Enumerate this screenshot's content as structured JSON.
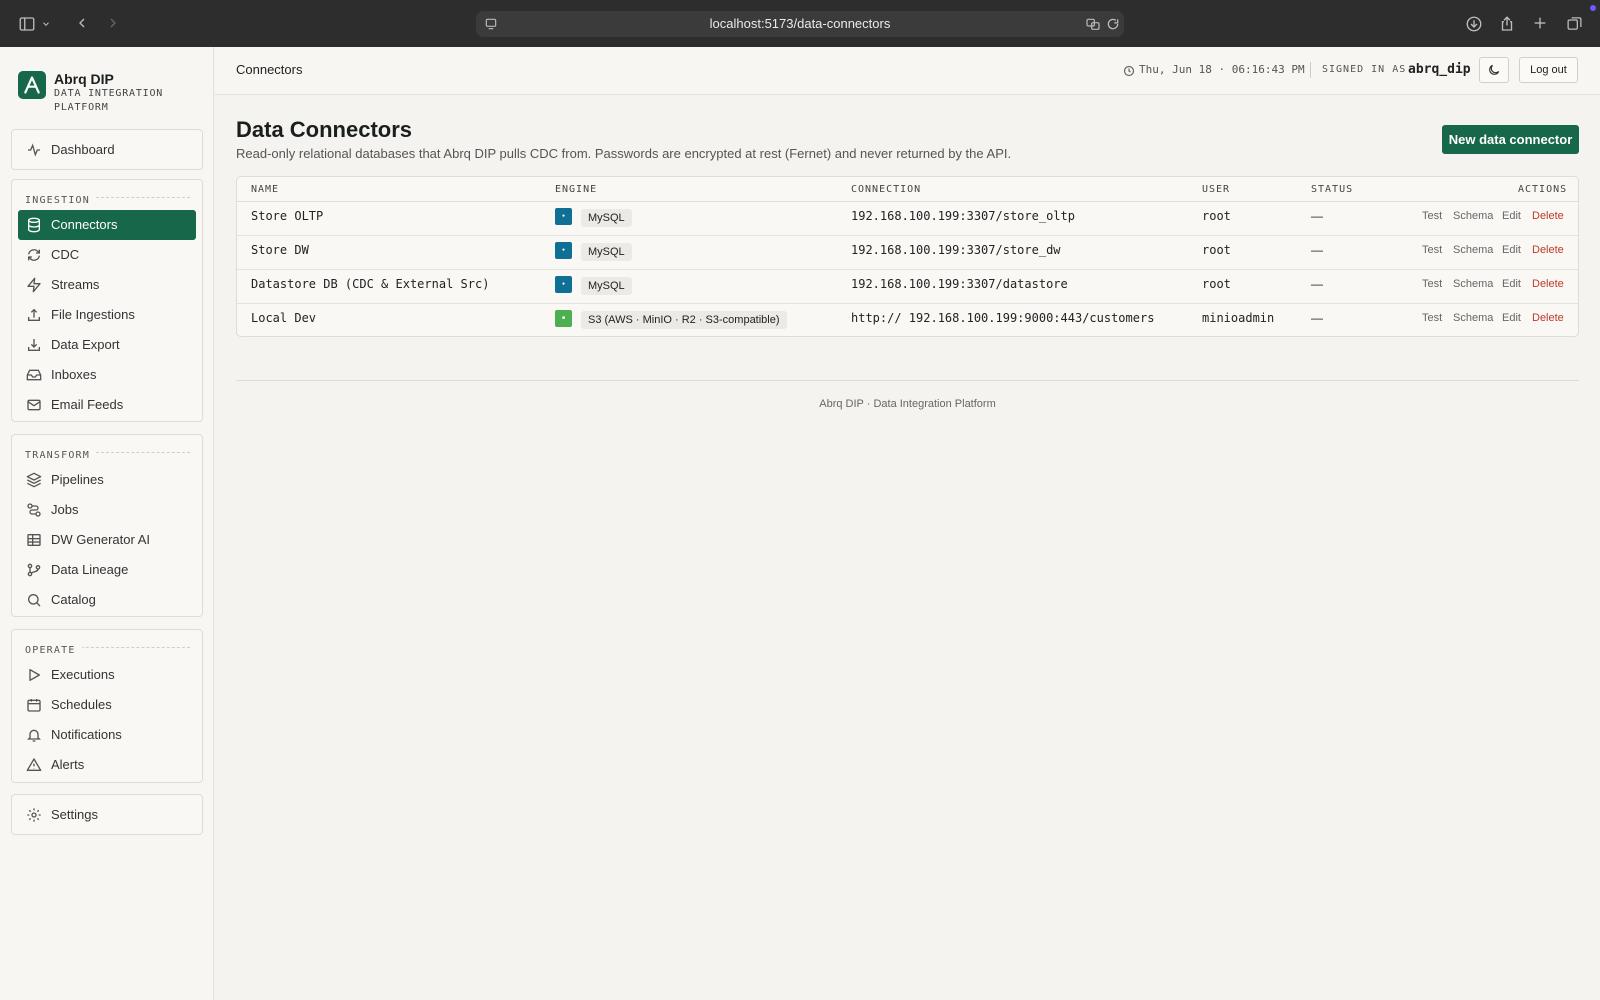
{
  "browser": {
    "url": "localhost:5173/data-connectors"
  },
  "brand": {
    "name": "Abrq DIP",
    "subtitle": "DATA INTEGRATION PLATFORM"
  },
  "sidebar": {
    "top_item": {
      "label": "Dashboard",
      "icon": "activity-icon"
    },
    "sections": [
      {
        "title": "INGESTION",
        "items": [
          {
            "label": "Connectors",
            "icon": "database-icon",
            "active": true
          },
          {
            "label": "CDC",
            "icon": "refresh-icon"
          },
          {
            "label": "Streams",
            "icon": "zap-icon"
          },
          {
            "label": "File Ingestions",
            "icon": "upload-icon"
          },
          {
            "label": "Data Export",
            "icon": "download-icon"
          },
          {
            "label": "Inboxes",
            "icon": "inbox-icon"
          },
          {
            "label": "Email Feeds",
            "icon": "mail-icon"
          }
        ]
      },
      {
        "title": "TRANSFORM",
        "items": [
          {
            "label": "Pipelines",
            "icon": "layers-icon"
          },
          {
            "label": "Jobs",
            "icon": "route-icon"
          },
          {
            "label": "DW Generator AI",
            "icon": "table-icon"
          },
          {
            "label": "Data Lineage",
            "icon": "git-branch-icon"
          },
          {
            "label": "Catalog",
            "icon": "search-icon"
          }
        ]
      },
      {
        "title": "OPERATE",
        "items": [
          {
            "label": "Executions",
            "icon": "play-icon"
          },
          {
            "label": "Schedules",
            "icon": "calendar-icon"
          },
          {
            "label": "Notifications",
            "icon": "bell-icon"
          },
          {
            "label": "Alerts",
            "icon": "alert-triangle-icon"
          }
        ]
      }
    ],
    "bottom_item": {
      "label": "Settings",
      "icon": "gear-icon"
    }
  },
  "header": {
    "breadcrumb": "Connectors",
    "datetime": "Thu, Jun 18 · 06:16:43 PM",
    "signed_in_label": "SIGNED IN AS",
    "username": "abrq_dip",
    "logout_label": "Log out"
  },
  "page": {
    "title": "Data Connectors",
    "description": "Read-only relational databases that Abrq DIP pulls CDC from. Passwords are encrypted at rest (Fernet) and never returned by the API.",
    "new_button": "New data connector"
  },
  "table": {
    "columns": [
      "NAME",
      "ENGINE",
      "CONNECTION",
      "USER",
      "STATUS",
      "ACTIONS"
    ],
    "rows": [
      {
        "name": "Store OLTP",
        "engine": "MySQL",
        "engine_color": "#0f6f94",
        "connection": "192.168.100.199:3307/store_oltp",
        "user": "root",
        "status": "—"
      },
      {
        "name": "Store DW",
        "engine": "MySQL",
        "engine_color": "#0f6f94",
        "connection": "192.168.100.199:3307/store_dw",
        "user": "root",
        "status": "—"
      },
      {
        "name": "Datastore DB (CDC & External Src)",
        "engine": "MySQL",
        "engine_color": "#0f6f94",
        "connection": "192.168.100.199:3307/datastore",
        "user": "root",
        "status": "—"
      },
      {
        "name": "Local Dev",
        "engine": "S3 (AWS · MinIO · R2 · S3-compatible)",
        "engine_color": "#4caf50",
        "connection": "http:// 192.168.100.199:9000:443/customers",
        "user": "minioadmin",
        "status": "—"
      }
    ],
    "actions": [
      "Test",
      "Schema",
      "Edit",
      "Delete"
    ]
  },
  "footer": {
    "text": "Abrq DIP · Data Integration Platform"
  },
  "colors": {
    "accent": "#17674a",
    "danger": "#c0392b",
    "chrome": "#2d2d2d"
  }
}
